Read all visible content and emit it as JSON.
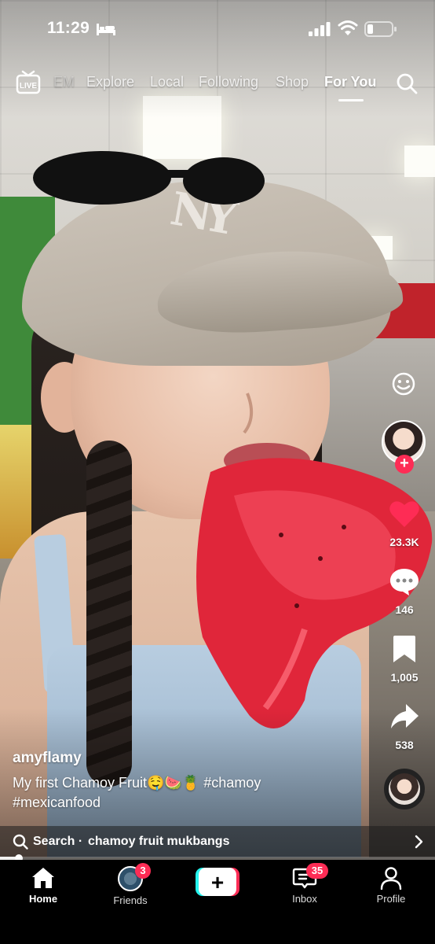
{
  "status_bar": {
    "time": "11:29",
    "focus_icon": "bed-icon",
    "signal_icon": "cellular-signal-icon",
    "wifi_icon": "wifi-icon",
    "battery_icon": "battery-low-icon"
  },
  "top_nav": {
    "live_label": "LIVE",
    "tabs": [
      {
        "label": "EM",
        "state": "faded"
      },
      {
        "label": "Explore",
        "state": "normal"
      },
      {
        "label": "Local",
        "state": "normal"
      },
      {
        "label": "Following",
        "state": "normal"
      },
      {
        "label": "Shop",
        "state": "normal"
      },
      {
        "label": "For You",
        "state": "active"
      }
    ],
    "search_icon": "search-icon"
  },
  "rail": {
    "like_count": "23.3K",
    "comment_count": "146",
    "bookmark_count": "1,005",
    "share_count": "538",
    "follow_symbol": "+",
    "like_color": "#fe2c55"
  },
  "caption": {
    "username": "amyflamy",
    "text": "My first Chamoy Fruit🤤🍉🍍",
    "hashtag1": "#chamoy",
    "hashtag2": "#mexicanfood"
  },
  "search_suggestion": {
    "prefix": "Search ·",
    "query": "chamoy fruit mukbangs"
  },
  "playback": {
    "progress_fraction": 0.04
  },
  "tab_bar": {
    "home": "Home",
    "friends": "Friends",
    "friends_badge": "3",
    "create_symbol": "+",
    "inbox": "Inbox",
    "inbox_badge": "35",
    "profile": "Profile",
    "accent_pink": "#fe2c55",
    "accent_cyan": "#25f4ee"
  }
}
